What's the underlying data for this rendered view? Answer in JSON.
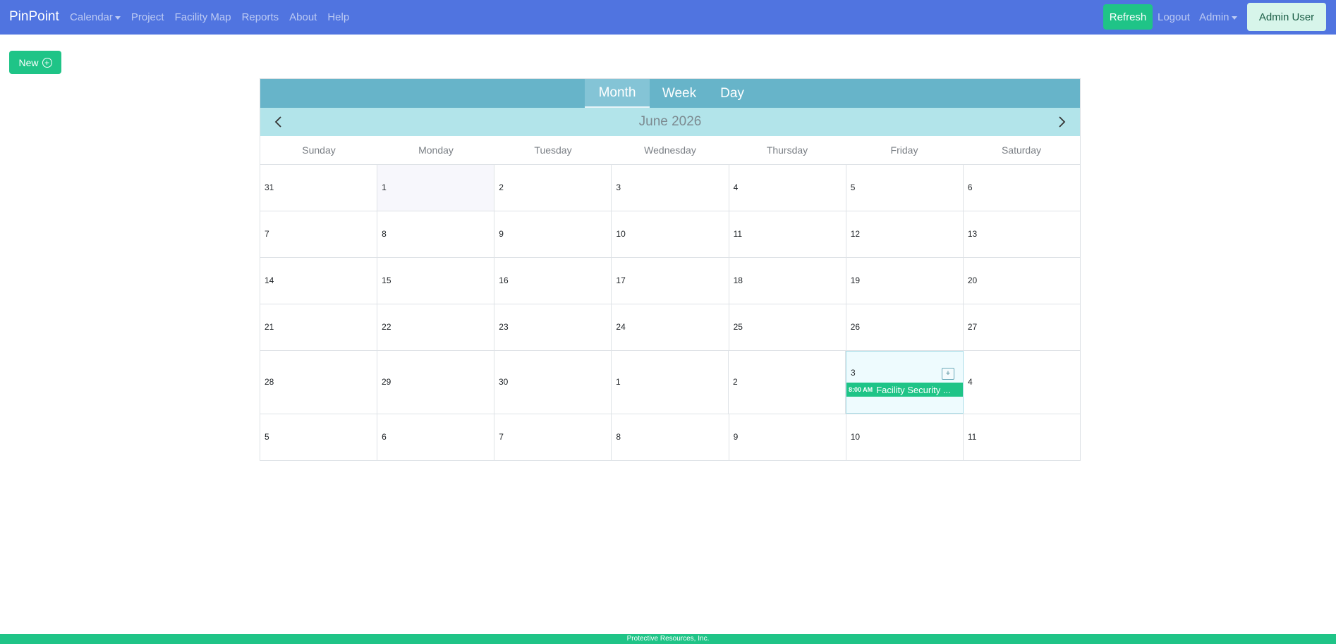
{
  "navbar": {
    "brand": "PinPoint",
    "items": [
      "Calendar",
      "Project",
      "Facility Map",
      "Reports",
      "About",
      "Help"
    ],
    "refresh_label": "Refresh",
    "logout_label": "Logout",
    "admin_label": "Admin",
    "user_label": "Admin User"
  },
  "toolbar": {
    "new_label": "New"
  },
  "calendar": {
    "views": [
      "Month",
      "Week",
      "Day"
    ],
    "active_view": "Month",
    "month_title": "June 2026",
    "days_of_week": [
      "Sunday",
      "Monday",
      "Tuesday",
      "Wednesday",
      "Thursday",
      "Friday",
      "Saturday"
    ],
    "weeks": [
      [
        "31",
        "1",
        "2",
        "3",
        "4",
        "5",
        "6"
      ],
      [
        "7",
        "8",
        "9",
        "10",
        "11",
        "12",
        "13"
      ],
      [
        "14",
        "15",
        "16",
        "17",
        "18",
        "19",
        "20"
      ],
      [
        "21",
        "22",
        "23",
        "24",
        "25",
        "26",
        "27"
      ],
      [
        "28",
        "29",
        "30",
        "1",
        "2",
        "3",
        "4"
      ],
      [
        "5",
        "6",
        "7",
        "8",
        "9",
        "10",
        "11"
      ]
    ],
    "event": {
      "time": "8:00 AM",
      "title": "Facility Security ..."
    },
    "add_label": "+"
  },
  "footer": {
    "text": "Protective Resources, Inc."
  },
  "colors": {
    "navbar": "#5074e0",
    "accent": "#1fc487",
    "view_bar": "#67b4c9",
    "month_bar": "#b2e4ea"
  }
}
